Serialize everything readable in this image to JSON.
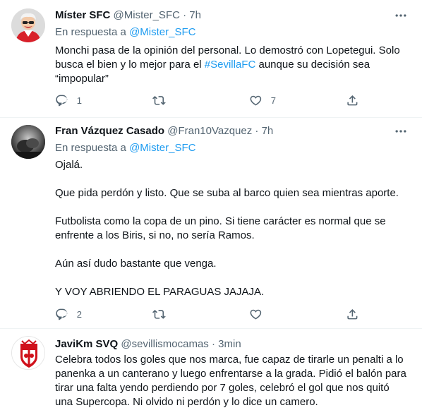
{
  "tweets": [
    {
      "name": "Míster SFC",
      "handle": "@Mister_SFC",
      "dot": "·",
      "time": "7h",
      "reply_prefix": "En respuesta a ",
      "reply_to": "@Mister_SFC",
      "text_before": "Monchi pasa de la opinión del personal. Lo demostró con Lopetegui. Solo busca el bien y lo mejor para el ",
      "hashtag": "#SevillaFC",
      "text_after": " aunque su decisión sea “impopular”",
      "reply_count": "1",
      "retweet_count": "",
      "like_count": "7",
      "avatar_icon": "cartoon-manager-avatar"
    },
    {
      "name": "Fran Vázquez Casado",
      "handle": "@Fran10Vazquez",
      "dot": "·",
      "time": "7h",
      "reply_prefix": "En respuesta a ",
      "reply_to": "@Mister_SFC",
      "paragraphs": [
        "Ojalá.",
        "Que pida perdón y listo. Que se suba al barco quien sea mientras aporte.",
        "Futbolista como la copa de un pino. Si tiene carácter es normal que se enfrente a los Biris, si no, no sería Ramos.",
        "Aún así dudo bastante que venga.",
        "Y VOY ABRIENDO EL PARAGUAS JAJAJA."
      ],
      "reply_count": "2",
      "retweet_count": "",
      "like_count": "",
      "avatar_icon": "dark-photo-avatar"
    },
    {
      "name": "JaviKm SVQ",
      "handle": "@sevillismocamas",
      "dot": "·",
      "time": "3min",
      "text": "Celebra todos los goles que nos marca, fue capaz de tirarle un penalti a lo panenka a un canterano y luego enfrentarse a la grada. Pidió el balón para tirar una falta yendo perdiendo por 7 goles, celebró el gol que nos quitó una Supercopa. Ni olvido ni perdón y lo dice un camero.",
      "avatar_icon": "sevilla-crest-avatar"
    }
  ],
  "colors": {
    "accent": "#1d9bf0",
    "secondary_text": "#536471",
    "primary_text": "#0f1419",
    "divider": "#eff3f4"
  }
}
